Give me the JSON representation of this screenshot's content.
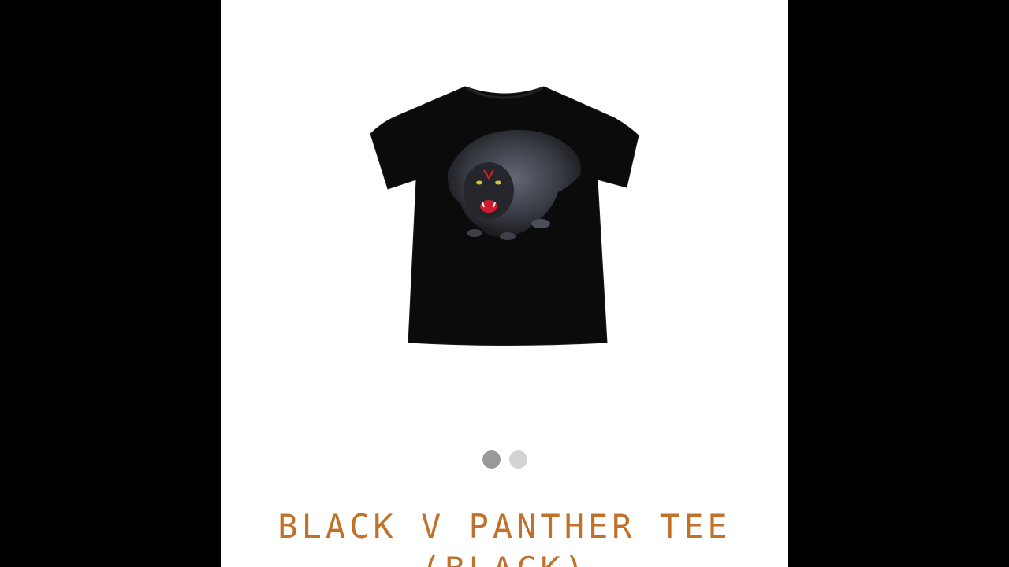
{
  "product": {
    "title": "BLACK V PANTHER TEE (BLACK)",
    "image_icon": "panther-tshirt-image"
  },
  "carousel": {
    "slide_count": 2,
    "active_index": 0
  },
  "colors": {
    "title": "#c0712a",
    "dot_active": "#999999",
    "dot_inactive": "#d3d3d3",
    "background": "#ffffff",
    "letterbox": "#000000"
  }
}
